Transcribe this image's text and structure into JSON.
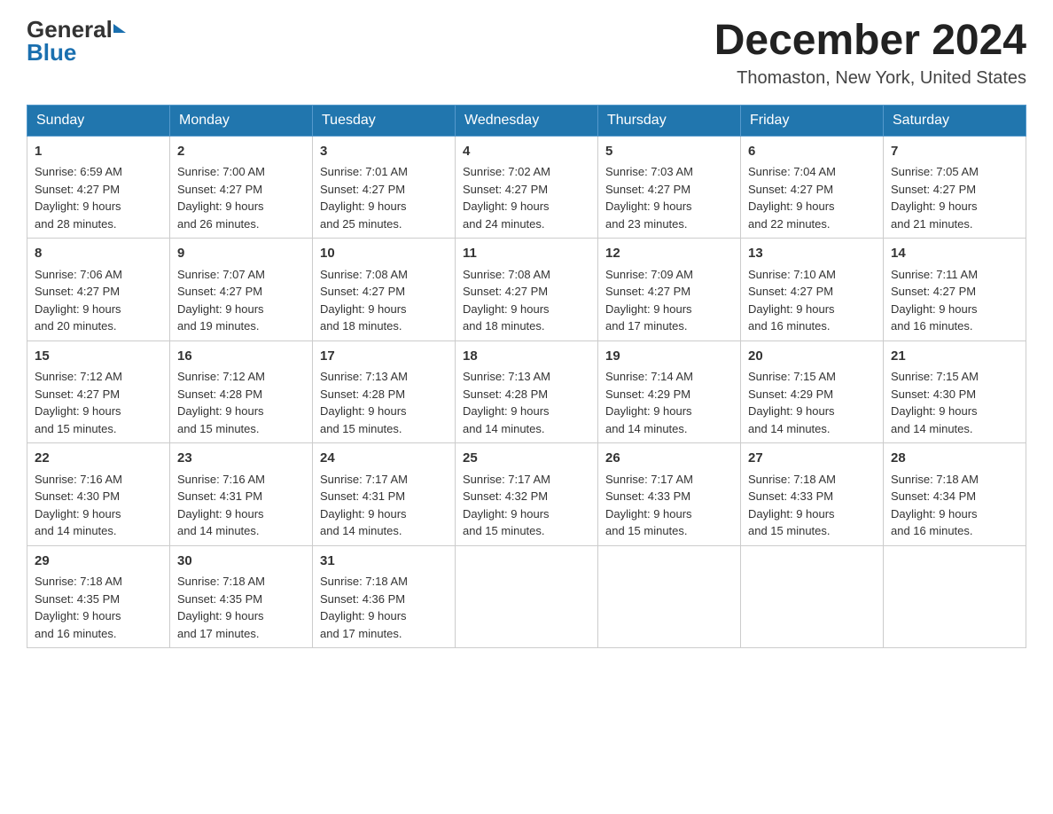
{
  "logo": {
    "general": "General",
    "blue": "Blue"
  },
  "header": {
    "month_title": "December 2024",
    "location": "Thomaston, New York, United States"
  },
  "weekdays": [
    "Sunday",
    "Monday",
    "Tuesday",
    "Wednesday",
    "Thursday",
    "Friday",
    "Saturday"
  ],
  "weeks": [
    [
      {
        "day": "1",
        "sunrise": "6:59 AM",
        "sunset": "4:27 PM",
        "daylight": "9 hours and 28 minutes."
      },
      {
        "day": "2",
        "sunrise": "7:00 AM",
        "sunset": "4:27 PM",
        "daylight": "9 hours and 26 minutes."
      },
      {
        "day": "3",
        "sunrise": "7:01 AM",
        "sunset": "4:27 PM",
        "daylight": "9 hours and 25 minutes."
      },
      {
        "day": "4",
        "sunrise": "7:02 AM",
        "sunset": "4:27 PM",
        "daylight": "9 hours and 24 minutes."
      },
      {
        "day": "5",
        "sunrise": "7:03 AM",
        "sunset": "4:27 PM",
        "daylight": "9 hours and 23 minutes."
      },
      {
        "day": "6",
        "sunrise": "7:04 AM",
        "sunset": "4:27 PM",
        "daylight": "9 hours and 22 minutes."
      },
      {
        "day": "7",
        "sunrise": "7:05 AM",
        "sunset": "4:27 PM",
        "daylight": "9 hours and 21 minutes."
      }
    ],
    [
      {
        "day": "8",
        "sunrise": "7:06 AM",
        "sunset": "4:27 PM",
        "daylight": "9 hours and 20 minutes."
      },
      {
        "day": "9",
        "sunrise": "7:07 AM",
        "sunset": "4:27 PM",
        "daylight": "9 hours and 19 minutes."
      },
      {
        "day": "10",
        "sunrise": "7:08 AM",
        "sunset": "4:27 PM",
        "daylight": "9 hours and 18 minutes."
      },
      {
        "day": "11",
        "sunrise": "7:08 AM",
        "sunset": "4:27 PM",
        "daylight": "9 hours and 18 minutes."
      },
      {
        "day": "12",
        "sunrise": "7:09 AM",
        "sunset": "4:27 PM",
        "daylight": "9 hours and 17 minutes."
      },
      {
        "day": "13",
        "sunrise": "7:10 AM",
        "sunset": "4:27 PM",
        "daylight": "9 hours and 16 minutes."
      },
      {
        "day": "14",
        "sunrise": "7:11 AM",
        "sunset": "4:27 PM",
        "daylight": "9 hours and 16 minutes."
      }
    ],
    [
      {
        "day": "15",
        "sunrise": "7:12 AM",
        "sunset": "4:27 PM",
        "daylight": "9 hours and 15 minutes."
      },
      {
        "day": "16",
        "sunrise": "7:12 AM",
        "sunset": "4:28 PM",
        "daylight": "9 hours and 15 minutes."
      },
      {
        "day": "17",
        "sunrise": "7:13 AM",
        "sunset": "4:28 PM",
        "daylight": "9 hours and 15 minutes."
      },
      {
        "day": "18",
        "sunrise": "7:13 AM",
        "sunset": "4:28 PM",
        "daylight": "9 hours and 14 minutes."
      },
      {
        "day": "19",
        "sunrise": "7:14 AM",
        "sunset": "4:29 PM",
        "daylight": "9 hours and 14 minutes."
      },
      {
        "day": "20",
        "sunrise": "7:15 AM",
        "sunset": "4:29 PM",
        "daylight": "9 hours and 14 minutes."
      },
      {
        "day": "21",
        "sunrise": "7:15 AM",
        "sunset": "4:30 PM",
        "daylight": "9 hours and 14 minutes."
      }
    ],
    [
      {
        "day": "22",
        "sunrise": "7:16 AM",
        "sunset": "4:30 PM",
        "daylight": "9 hours and 14 minutes."
      },
      {
        "day": "23",
        "sunrise": "7:16 AM",
        "sunset": "4:31 PM",
        "daylight": "9 hours and 14 minutes."
      },
      {
        "day": "24",
        "sunrise": "7:17 AM",
        "sunset": "4:31 PM",
        "daylight": "9 hours and 14 minutes."
      },
      {
        "day": "25",
        "sunrise": "7:17 AM",
        "sunset": "4:32 PM",
        "daylight": "9 hours and 15 minutes."
      },
      {
        "day": "26",
        "sunrise": "7:17 AM",
        "sunset": "4:33 PM",
        "daylight": "9 hours and 15 minutes."
      },
      {
        "day": "27",
        "sunrise": "7:18 AM",
        "sunset": "4:33 PM",
        "daylight": "9 hours and 15 minutes."
      },
      {
        "day": "28",
        "sunrise": "7:18 AM",
        "sunset": "4:34 PM",
        "daylight": "9 hours and 16 minutes."
      }
    ],
    [
      {
        "day": "29",
        "sunrise": "7:18 AM",
        "sunset": "4:35 PM",
        "daylight": "9 hours and 16 minutes."
      },
      {
        "day": "30",
        "sunrise": "7:18 AM",
        "sunset": "4:35 PM",
        "daylight": "9 hours and 17 minutes."
      },
      {
        "day": "31",
        "sunrise": "7:18 AM",
        "sunset": "4:36 PM",
        "daylight": "9 hours and 17 minutes."
      },
      null,
      null,
      null,
      null
    ]
  ],
  "labels": {
    "sunrise": "Sunrise:",
    "sunset": "Sunset:",
    "daylight": "Daylight:"
  }
}
